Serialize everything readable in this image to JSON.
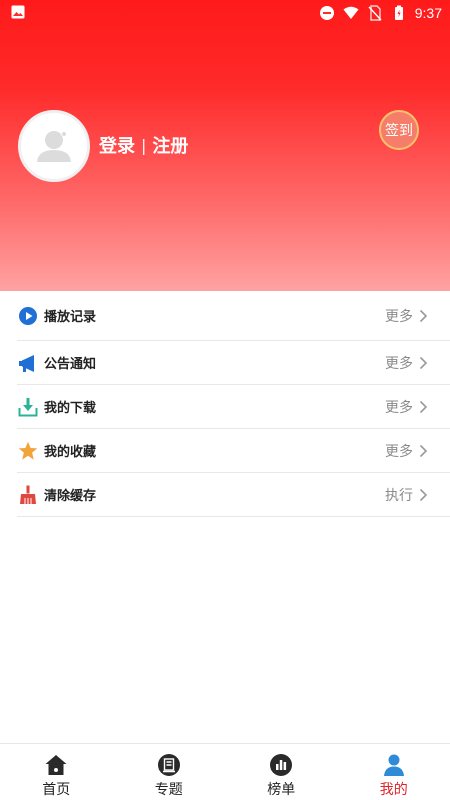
{
  "status_bar": {
    "time": "9:37"
  },
  "profile": {
    "login_label": "登录",
    "separator": "|",
    "register_label": "注册",
    "sign_in_button": "签到"
  },
  "menu": {
    "items": [
      {
        "label": "播放记录",
        "action": "更多",
        "icon": "play-icon"
      },
      {
        "label": "公告通知",
        "action": "更多",
        "icon": "megaphone-icon"
      },
      {
        "label": "我的下载",
        "action": "更多",
        "icon": "download-icon"
      },
      {
        "label": "我的收藏",
        "action": "更多",
        "icon": "star-icon"
      },
      {
        "label": "清除缓存",
        "action": "执行",
        "icon": "broom-icon"
      }
    ]
  },
  "tabbar": {
    "tabs": [
      {
        "label": "首页",
        "icon": "home-icon",
        "active": false
      },
      {
        "label": "专题",
        "icon": "topic-icon",
        "active": false
      },
      {
        "label": "榜单",
        "icon": "chart-icon",
        "active": false
      },
      {
        "label": "我的",
        "icon": "user-icon",
        "active": true
      }
    ]
  },
  "colors": {
    "header_top": "#ff1a1a",
    "header_bottom": "#ffa2a2",
    "active_tab": "#e0232b",
    "play_icon": "#1f6fd6",
    "megaphone_icon": "#1f6fd6",
    "download_icon": "#2bb39a",
    "star_icon": "#f2a33a",
    "broom_icon": "#e0473d"
  }
}
